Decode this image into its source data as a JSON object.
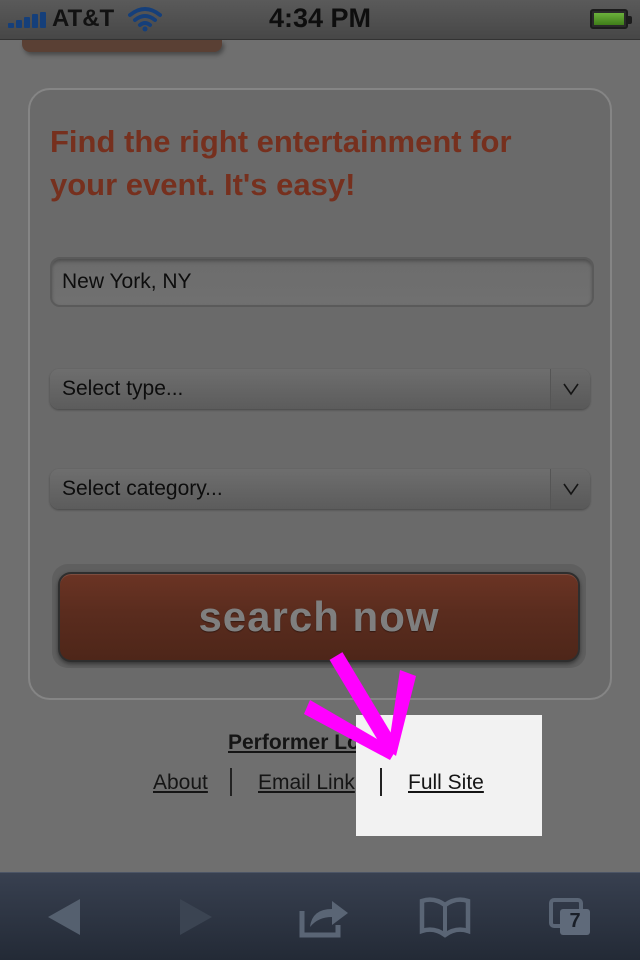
{
  "status_bar": {
    "carrier": "AT&T",
    "time": "4:34 PM",
    "icons": [
      "signal-bars-icon",
      "wifi-icon",
      "battery-icon"
    ]
  },
  "form": {
    "headline": "Find the right entertainment for your event. It's easy!",
    "location_value": "New York, NY",
    "type_select": "Select type...",
    "category_select": "Select category...",
    "search_button": "search now"
  },
  "footer": {
    "performer_login": "Performer Login",
    "about": "About",
    "email_link": "Email Link",
    "full_site": "Full Site"
  },
  "toolbar": {
    "tabs_count": "7",
    "icons": [
      "back-arrow-icon",
      "forward-arrow-icon",
      "share-icon",
      "bookmarks-icon",
      "tabs-icon"
    ]
  },
  "colors": {
    "headline": "#76301e",
    "button": "#5a2c1e",
    "annotation_arrow": "#ff00ff"
  }
}
